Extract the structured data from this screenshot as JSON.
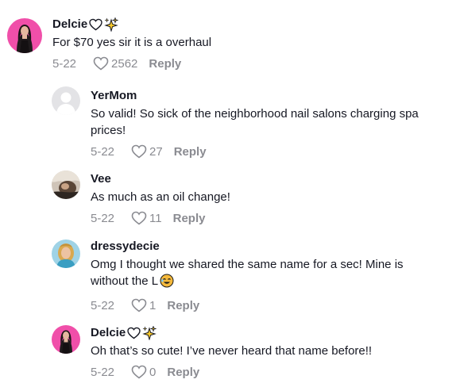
{
  "comments": [
    {
      "username": "Delcie",
      "text": "For $70 yes sir it is a overhaul",
      "date": "5-22",
      "likes": "2562",
      "reply_label": "Reply",
      "avatar_icon": "profile-photo-dark-hair",
      "name_icons": [
        "heart-outline-icon",
        "sparkles-icon"
      ]
    },
    {
      "username": "YerMom",
      "text": "So valid! So sick of the neighborhood nail salons charging spa prices!",
      "date": "5-22",
      "likes": "27",
      "reply_label": "Reply",
      "avatar_icon": "default-avatar-icon"
    },
    {
      "username": "Vee",
      "text": "As much as an oil change!",
      "date": "5-22",
      "likes": "11",
      "reply_label": "Reply",
      "avatar_icon": "profile-photo"
    },
    {
      "username": "dressydecie",
      "text_line1": "Omg I thought we shared the same name for a sec! Mine is",
      "text_line2": "without the L",
      "emoji": "laughing-face-emoji",
      "date": "5-22",
      "likes": "1",
      "reply_label": "Reply",
      "avatar_icon": "profile-photo"
    },
    {
      "username": "Delcie",
      "text": "Oh that’s so cute! I’ve never heard that name before!!",
      "date": "5-22",
      "likes": "0",
      "reply_label": "Reply",
      "avatar_icon": "profile-photo-dark-hair",
      "name_icons": [
        "heart-outline-icon",
        "sparkles-icon"
      ]
    }
  ],
  "colors": {
    "text_primary": "#161823",
    "text_secondary": "#8a8b91",
    "avatar_pink": "#f04fa9",
    "avatar_default": "#e3e3e6",
    "sparkle_yellow": "#f7c82a"
  }
}
